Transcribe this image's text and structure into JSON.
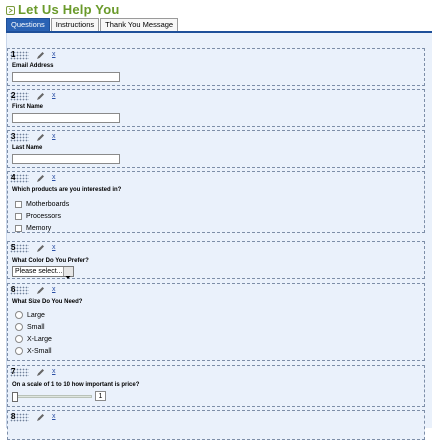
{
  "header": {
    "title": "Let Us Help You"
  },
  "tabs": [
    {
      "label": "Questions",
      "active": true
    },
    {
      "label": "Instructions",
      "active": false
    },
    {
      "label": "Thank You Message",
      "active": false
    }
  ],
  "question_tool": {
    "delete_label": "x"
  },
  "questions": [
    {
      "number": "1",
      "label": "Email Address",
      "type": "text"
    },
    {
      "number": "2",
      "label": "First Name",
      "type": "text"
    },
    {
      "number": "3",
      "label": "Last Name",
      "type": "text"
    },
    {
      "number": "4",
      "label": "Which products are you interested in?",
      "type": "checkbox",
      "options": [
        "Motherboards",
        "Processors",
        "Memory"
      ]
    },
    {
      "number": "5",
      "label": "What Color Do You Prefer?",
      "type": "select",
      "selected": "Please select..."
    },
    {
      "number": "6",
      "label": "What Size Do You Need?",
      "type": "radio",
      "options": [
        "Large",
        "Small",
        "X-Large",
        "X-Small"
      ]
    },
    {
      "number": "7",
      "label": "On a scale of 1 to 10 how important is price?",
      "type": "slider",
      "value": "1",
      "fraction": 0.0
    },
    {
      "number": "8",
      "label": "",
      "type": "partial"
    }
  ],
  "colors": {
    "accent_title": "#6a9a2a",
    "tab_active": "#2a62b4",
    "panel_bg": "#eaf1fb"
  }
}
